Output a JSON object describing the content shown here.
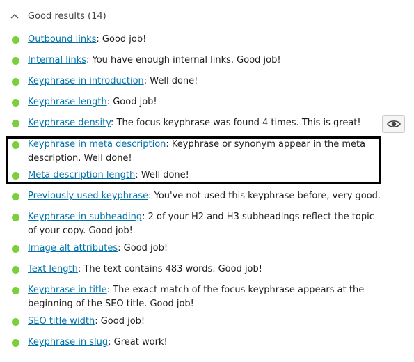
{
  "colors": {
    "good": "#7ad03a",
    "link": "#0073aa"
  },
  "header": {
    "title": "Good results (14)",
    "icon": "chevron-up-icon"
  },
  "items": [
    {
      "link": "Outbound links",
      "text": ": Good job!"
    },
    {
      "link": "Internal links",
      "text": ": You have enough internal links. Good job!"
    },
    {
      "link": "Keyphrase in introduction",
      "text": ": Well done!"
    },
    {
      "link": "Keyphrase length",
      "text": ": Good job!"
    },
    {
      "link": "Keyphrase density",
      "text": ": The focus keyphrase was found 4 times. This is great!"
    },
    {
      "link": "Keyphrase in meta description",
      "text": ": Keyphrase or synonym appear in the meta description. Well done!"
    },
    {
      "link": "Meta description length",
      "text": ": Well done!"
    },
    {
      "link": "Previously used keyphrase",
      "text": ": You've not used this keyphrase before, very good."
    },
    {
      "link": "Keyphrase in subheading",
      "text": ": 2 of your H2 and H3 subheadings reflect the topic of your copy. Good job!"
    },
    {
      "link": "Image alt attributes",
      "text": ": Good job!"
    },
    {
      "link": "Text length",
      "text": ": The text contains 483 words. Good job!"
    },
    {
      "link": "Keyphrase in title",
      "text": ": The exact match of the focus keyphrase appears at the beginning of the SEO title. Good job!"
    },
    {
      "link": "SEO title width",
      "text": ": Good job!"
    },
    {
      "link": "Keyphrase in slug",
      "text": ": Great work!"
    }
  ],
  "eye_button": {
    "icon": "eye-icon"
  }
}
